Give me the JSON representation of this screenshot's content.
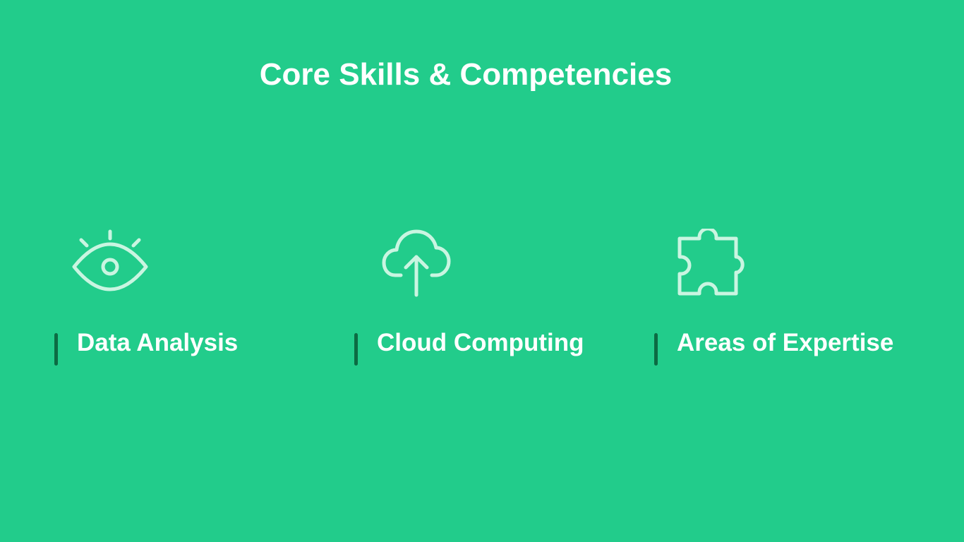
{
  "slide": {
    "title": "Core Skills & Competencies",
    "colors": {
      "background": "#22cc8b",
      "icon_stroke": "#c9f5e1",
      "accent_bar": "#0c6b43",
      "text": "#ffffff"
    }
  },
  "cards": [
    {
      "icon": "eye-icon",
      "label": "Data Analysis"
    },
    {
      "icon": "cloud-upload-icon",
      "label": "Cloud Computing"
    },
    {
      "icon": "puzzle-piece-icon",
      "label": "Areas of Expertise"
    }
  ]
}
